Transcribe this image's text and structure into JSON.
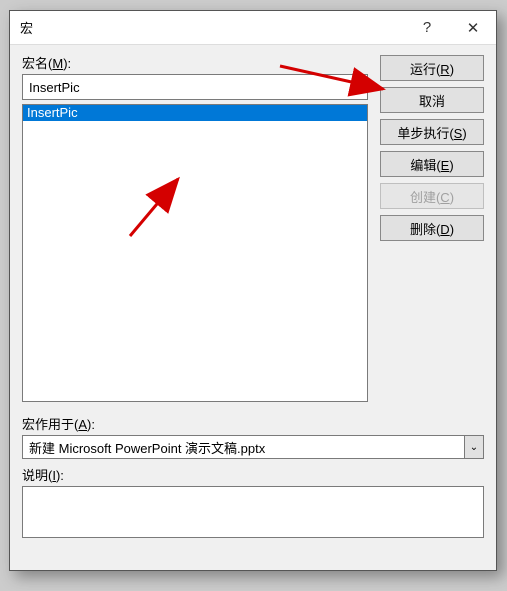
{
  "titlebar": {
    "title": "宏",
    "help": "?",
    "close": "✕"
  },
  "labels": {
    "macro_name": "宏名(",
    "macro_name_key": "M",
    "macro_name_suffix": "):",
    "macro_in": "宏作用于(",
    "macro_in_key": "A",
    "macro_in_suffix": "):",
    "description": "说明(",
    "description_key": "I",
    "description_suffix": "):"
  },
  "macro_name_value": "InsertPic",
  "list_items": [
    "InsertPic"
  ],
  "buttons": {
    "run": {
      "pre": "运行(",
      "key": "R",
      "suf": ")"
    },
    "cancel": {
      "pre": "取消",
      "key": "",
      "suf": ""
    },
    "step": {
      "pre": "单步执行(",
      "key": "S",
      "suf": ")"
    },
    "edit": {
      "pre": "编辑(",
      "key": "E",
      "suf": ")"
    },
    "create": {
      "pre": "创建(",
      "key": "C",
      "suf": ")"
    },
    "delete": {
      "pre": "删除(",
      "key": "D",
      "suf": ")"
    }
  },
  "macro_in_value": "新建 Microsoft PowerPoint 演示文稿.pptx",
  "dropdown_arrow": "⌄"
}
